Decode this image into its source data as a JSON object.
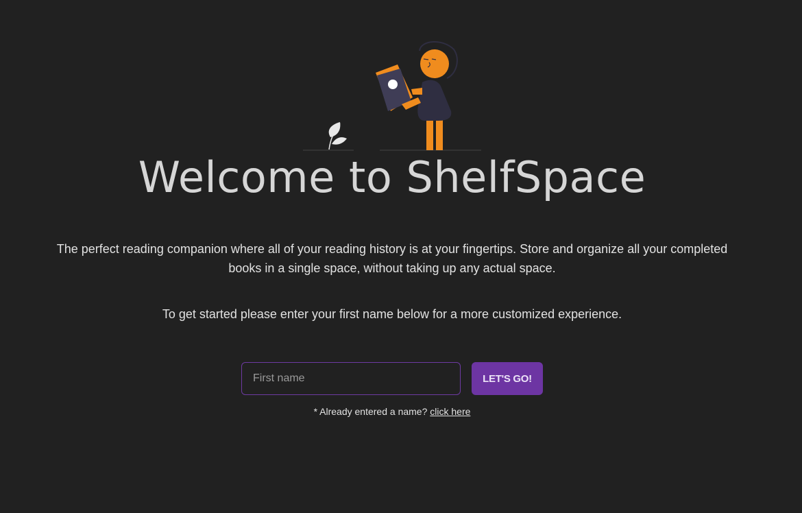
{
  "hero": {
    "title": "Welcome to ShelfSpace",
    "intro": "The perfect reading companion where all of your reading history is at your fingertips. Store and organize all your completed books in a single space, without taking up any actual space.",
    "cta": "To get started please enter your first name below for a more customized experience."
  },
  "form": {
    "name_placeholder": "First name",
    "name_value": "",
    "submit_label": "LET'S GO!"
  },
  "footnote": {
    "prefix": "* Already entered a name?",
    "link_label": "click here"
  },
  "colors": {
    "background": "#212121",
    "accent": "#6d35a3",
    "illustration_orange": "#f08c1e",
    "illustration_dark": "#2f2e41"
  },
  "icons": {
    "illustration": "person-reading-book-illustration"
  }
}
